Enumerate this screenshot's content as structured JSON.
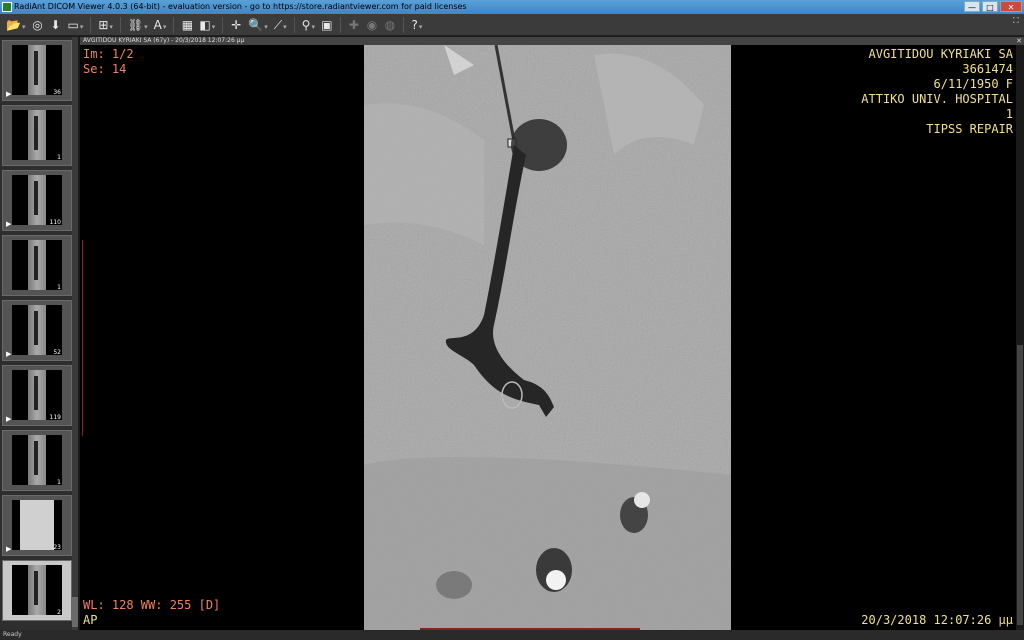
{
  "window": {
    "title": "RadiAnt DICOM Viewer 4.0.3 (64-bit) - evaluation version - go to https://store.radiantviewer.com for paid licenses",
    "minimize": "—",
    "maximize": "□",
    "close": "✕"
  },
  "toolbar": {
    "items": [
      {
        "name": "open-folder-icon",
        "glyph": "📂",
        "dropdown": true
      },
      {
        "name": "cd-icon",
        "glyph": "◎",
        "dropdown": false
      },
      {
        "name": "download-icon",
        "glyph": "⬇",
        "dropdown": false
      },
      {
        "name": "export-icon",
        "glyph": "▭",
        "dropdown": true
      },
      {
        "name": "layout-grid-icon",
        "glyph": "⊞",
        "dropdown": true
      },
      {
        "name": "link-icon",
        "glyph": "⛓",
        "dropdown": true
      },
      {
        "name": "text-annotation-icon",
        "glyph": "A",
        "dropdown": true
      },
      {
        "name": "series-sync-icon",
        "glyph": "▦",
        "dropdown": false
      },
      {
        "name": "window-level-icon",
        "glyph": "◧",
        "dropdown": true
      },
      {
        "name": "crosshair-icon",
        "glyph": "✛",
        "dropdown": false
      },
      {
        "name": "zoom-icon",
        "glyph": "🔍",
        "dropdown": true
      },
      {
        "name": "measure-icon",
        "glyph": "⟋",
        "dropdown": true
      },
      {
        "name": "user-icon",
        "glyph": "⚲",
        "dropdown": true
      },
      {
        "name": "snapshot-icon",
        "glyph": "▣",
        "dropdown": false
      },
      {
        "name": "mpr-icon",
        "glyph": "✚",
        "dropdown": false,
        "dim": true
      },
      {
        "name": "volume-icon",
        "glyph": "◉",
        "dropdown": false,
        "dim": true
      },
      {
        "name": "fusion-icon",
        "glyph": "◍",
        "dropdown": false,
        "dim": true
      },
      {
        "name": "help-icon",
        "glyph": "?",
        "dropdown": true
      }
    ]
  },
  "sidebar": {
    "thumbnails": [
      {
        "count": "36",
        "play": true,
        "variant": "dark"
      },
      {
        "count": "1",
        "play": false,
        "variant": "dark"
      },
      {
        "count": "110",
        "play": true,
        "variant": "dark"
      },
      {
        "count": "1",
        "play": false,
        "variant": "dark"
      },
      {
        "count": "52",
        "play": true,
        "variant": "dark"
      },
      {
        "count": "119",
        "play": true,
        "variant": "dark"
      },
      {
        "count": "1",
        "play": false,
        "variant": "dark"
      },
      {
        "count": "23",
        "play": true,
        "variant": "light"
      },
      {
        "count": "2",
        "play": false,
        "variant": "active"
      }
    ]
  },
  "viewer": {
    "header": "AVGITIDOU KYRIAKI SA (67y) - 20/3/2018 12:07:26 μμ",
    "close": "✕",
    "overlay": {
      "image_index": "Im: 1/2",
      "series": "Se: 14",
      "patient_name": "AVGITIDOU KYRIAKI SA",
      "patient_id": "3661474",
      "dob_sex": "6/11/1950 F",
      "institution": "ATTIKO UNIV. HOSPITAL",
      "study_number": "1",
      "study_description": "TIPSS REPAIR",
      "window_level": "WL: 128 WW: 255 [D]",
      "orientation": "AP",
      "datetime": "20/3/2018 12:07:26 μμ"
    }
  },
  "status": {
    "text": "Ready"
  }
}
